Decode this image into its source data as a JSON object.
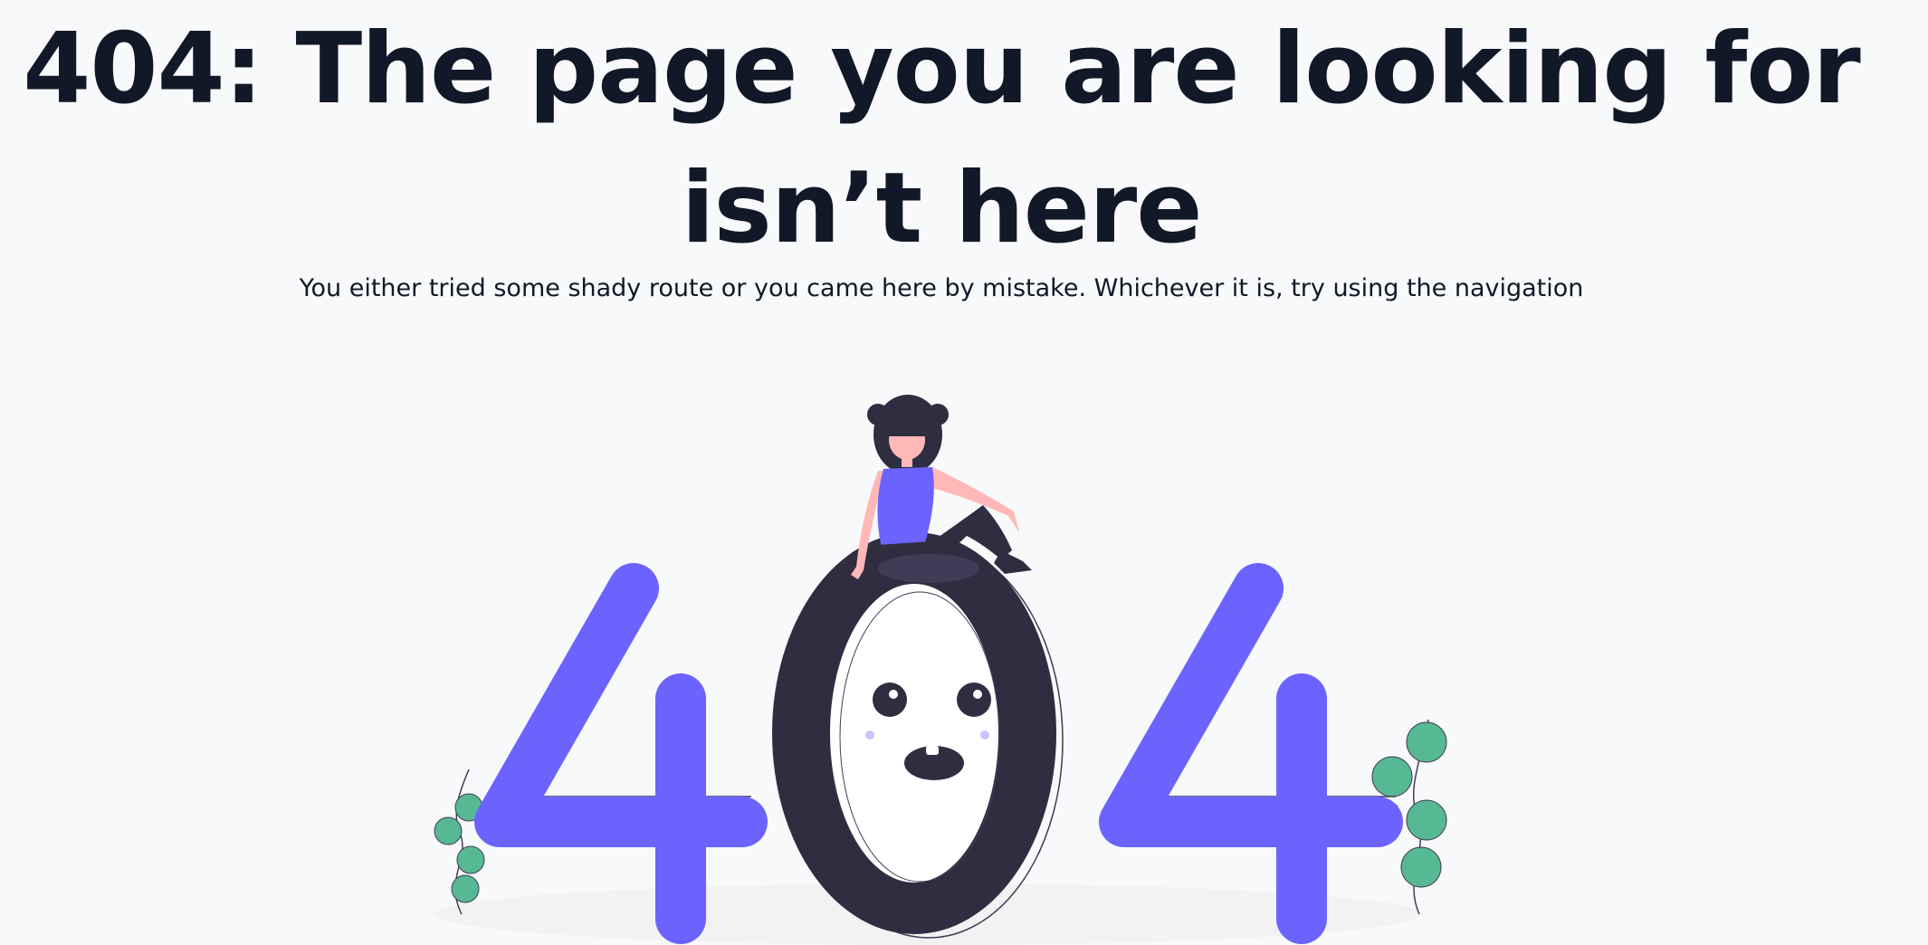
{
  "page": {
    "heading": "404: The page you are looking for isn’t here",
    "subtext": "You either tried some shady route or you came here by mistake. Whichever it is, try using the navigation"
  },
  "illustration": {
    "label": "404 illustration with a woman sitting on the zero",
    "colors": {
      "accent": "#6c63ff",
      "dark": "#2f2e41",
      "skin": "#ffb8b8",
      "leaf": "#57b894",
      "shadow": "#f2f2f2",
      "background": "#f8f9fb",
      "text": "#111827"
    }
  }
}
